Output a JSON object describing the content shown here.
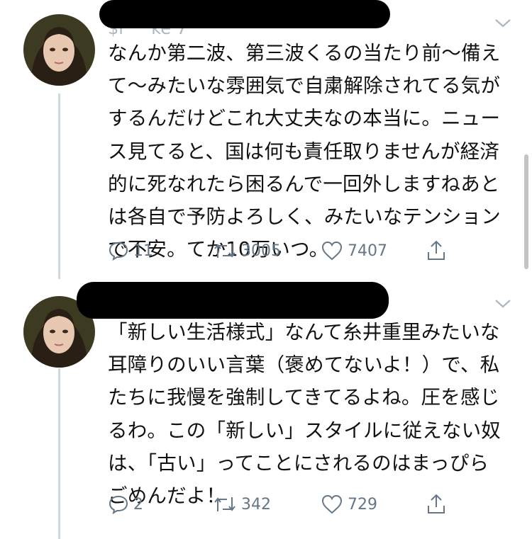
{
  "tweets": [
    {
      "header_text": "$l 　 ke 7",
      "body_lines": [
        "なんか第二波、第三波くるの当たり前〜備え",
        "て〜みたいな雰囲気で自粛解除されてる気が",
        "するんだけどこれ大丈夫なの本当に。ニュー",
        "ス見てると、国は何も責任取りませんが経済",
        "的に死なれたら困るんで一回外しますねあと",
        "は各自で予防よろしく、みたいなテンション",
        "で不安。てか10万いつ。"
      ],
      "replies": "11",
      "retweets": "3005",
      "likes": "7407"
    },
    {
      "header_text": "$",
      "body_lines": [
        "「新しい生活様式」なんて糸井重里みたいな",
        "耳障りのいい言葉（褒めてないよ！）で、私",
        "たちに我慢を強制してきてるよね。圧を感じ",
        "るわ。この「新しい」スタイルに従えない奴",
        "は、「古い」ってことにされるのはまっぴら",
        "ごめんだよ！"
      ],
      "replies": "2",
      "retweets": "342",
      "likes": "729"
    }
  ],
  "icons": {
    "reply": "reply-icon",
    "retweet": "retweet-icon",
    "like": "heart-icon",
    "share": "share-icon",
    "menu": "chevron-down-icon"
  },
  "colors": {
    "icon_gray": "#657786",
    "thread_line": "#cfd9de",
    "text": "#111111"
  }
}
